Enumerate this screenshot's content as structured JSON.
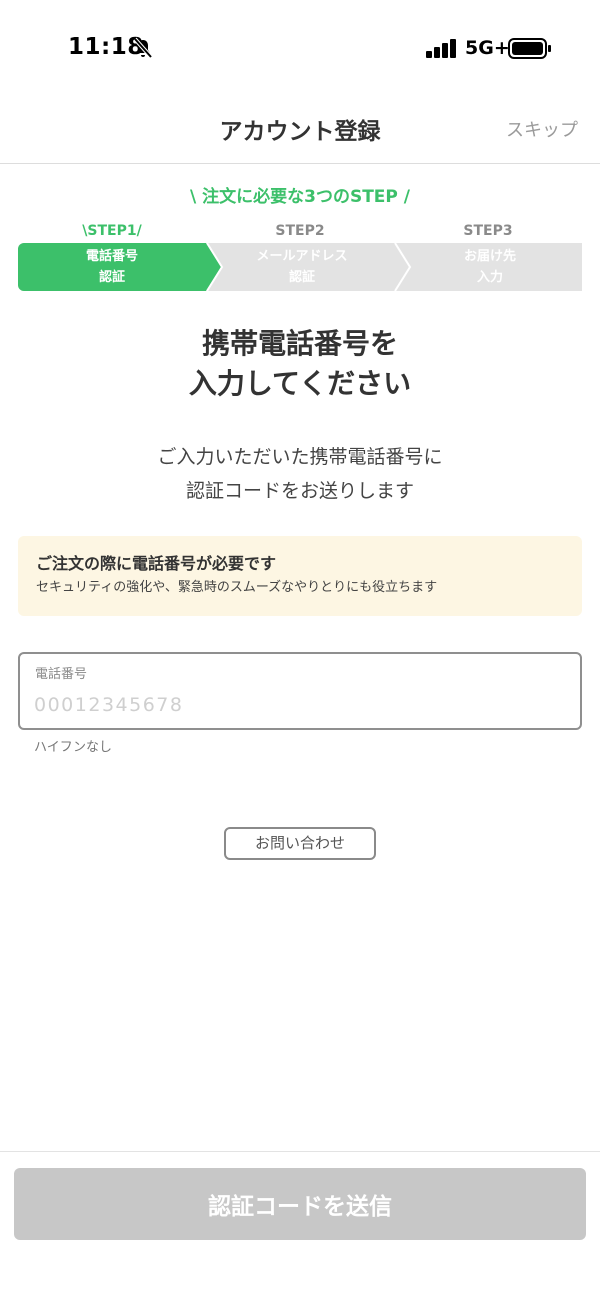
{
  "status_bar": {
    "time": "11:18",
    "network": "5G+"
  },
  "header": {
    "title": "アカウント登録",
    "skip_label": "スキップ"
  },
  "steps": {
    "banner": "\\ 注文に必要な3つのSTEP /",
    "items": [
      {
        "caption": "\\STEP1/",
        "line1": "電話番号",
        "line2": "認証",
        "active": true
      },
      {
        "caption": "STEP2",
        "line1": "メールアドレス",
        "line2": "認証",
        "active": false
      },
      {
        "caption": "STEP3",
        "line1": "お届け先",
        "line2": "入力",
        "active": false
      }
    ]
  },
  "main": {
    "headline_line1": "携帯電話番号を",
    "headline_line2": "入力してください",
    "subtext_line1": "ご入力いただいた携帯電話番号に",
    "subtext_line2": "認証コードをお送りします"
  },
  "notice": {
    "title": "ご注文の際に電話番号が必要です",
    "body": "セキュリティの強化や、緊急時のスムーズなやりとりにも役立ちます"
  },
  "phone_field": {
    "label": "電話番号",
    "value": "",
    "placeholder": "00012345678",
    "hint": "ハイフンなし"
  },
  "contact_button": {
    "label": "お問い合わせ"
  },
  "footer": {
    "send_label": "認証コードを送信"
  },
  "colors": {
    "accent": "#3cc06a",
    "inactive_step": "#e3e3e3",
    "notice_bg": "#fdf6e3",
    "disabled_button": "#c7c7c7"
  }
}
